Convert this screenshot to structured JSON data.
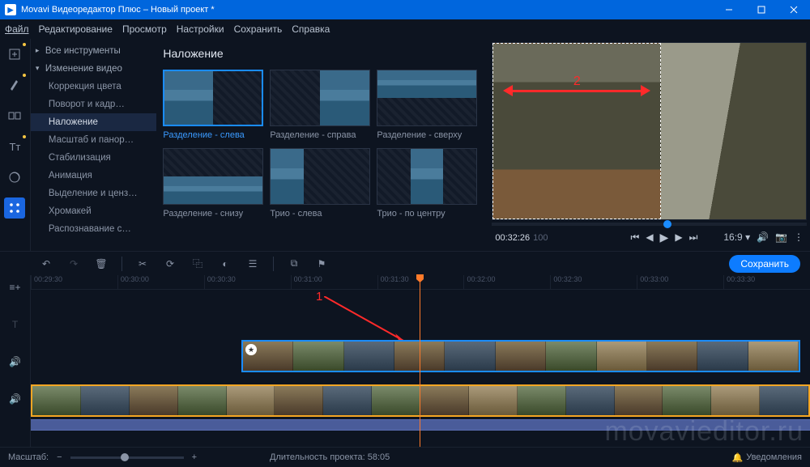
{
  "titlebar": {
    "app": "Movavi Видеоредактор Плюс – Новый проект *"
  },
  "menubar": [
    "Файл",
    "Редактирование",
    "Просмотр",
    "Настройки",
    "Сохранить",
    "Справка"
  ],
  "sidebar": {
    "all_tools": "Все инструменты",
    "group": "Изменение видео",
    "items": [
      "Коррекция цвета",
      "Поворот и кадр…",
      "Наложение",
      "Масштаб и панор…",
      "Стабилизация",
      "Анимация",
      "Выделение и ценз…",
      "Хромакей",
      "Распознавание с…"
    ],
    "selected": "Наложение"
  },
  "presets": {
    "title": "Наложение",
    "items": [
      "Разделение - слева",
      "Разделение - справа",
      "Разделение - сверху",
      "Разделение - снизу",
      "Трио - слева",
      "Трио - по центру"
    ],
    "selected_index": 0
  },
  "preview": {
    "time": "00:32:26",
    "frames": "100",
    "ratio": "16:9",
    "annotation": "2"
  },
  "toolbar": {
    "save": "Сохранить"
  },
  "ruler": [
    "00:29:30",
    "00:30:00",
    "00:30:30",
    "00:31:00",
    "00:31:30",
    "00:32:00",
    "00:32:30",
    "00:33:00",
    "00:33:30"
  ],
  "timeline": {
    "annotation": "1"
  },
  "status": {
    "zoom_label": "Масштаб:",
    "duration_label": "Длительность проекта:",
    "duration": "58:05",
    "notifications": "Уведомления"
  },
  "watermark": "movavieditor.ru"
}
